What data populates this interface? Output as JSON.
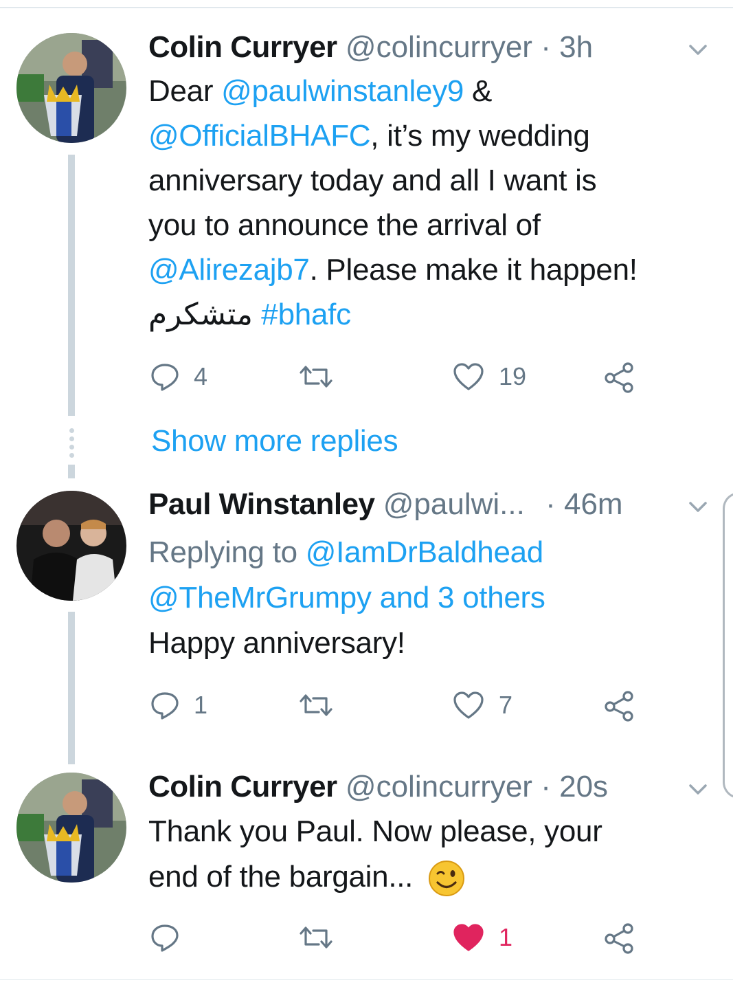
{
  "tweets": [
    {
      "name": "Colin Curryer",
      "handle": "@colincurryer",
      "separator": "·",
      "time": "3h",
      "body": {
        "l1_text": "Dear ",
        "l1_link": "@paulwinstanley9",
        "l1_tail": " &",
        "l2_link": "@OfficialBHAFC",
        "l2_tail": ", it’s my wedding",
        "l3": "anniversary today and all I want is",
        "l4": "you to announce the arrival of",
        "l5_link": "@Alirezajb7",
        "l5_tail": ". Please make it happen!",
        "l6_arabic": "متشكرم",
        "l6_hashtag": "#bhafc"
      },
      "replies": "4",
      "retweets": "",
      "likes": "19"
    },
    {
      "name": "Paul Winstanley",
      "handle": "@paulwi...",
      "separator": "·",
      "time": "46m",
      "replying_to_label": "Replying to",
      "replying_to_1": "@IamDrBaldhead",
      "replying_to_2": "@TheMrGrumpy and 3 others",
      "body": "Happy anniversary!",
      "replies": "1",
      "retweets": "",
      "likes": "7"
    },
    {
      "name": "Colin Curryer",
      "handle": "@colincurryer",
      "separator": "·",
      "time": "20s",
      "body": {
        "l1": "Thank you Paul. Now please, your",
        "l2": "end of the bargain..."
      },
      "replies": "",
      "retweets": "",
      "likes": "1",
      "liked": true
    }
  ],
  "show_more_replies": "Show more replies",
  "icons": {
    "reply": "reply-icon",
    "retweet": "retweet-icon",
    "like": "heart-icon",
    "share": "share-icon",
    "caret": "chevron-down-icon",
    "emoji": "winking-face-icon"
  },
  "colors": {
    "link": "#1da1f2",
    "secondary": "#657786",
    "like_active": "#e0245e",
    "thread_line": "#ccd6dd"
  }
}
